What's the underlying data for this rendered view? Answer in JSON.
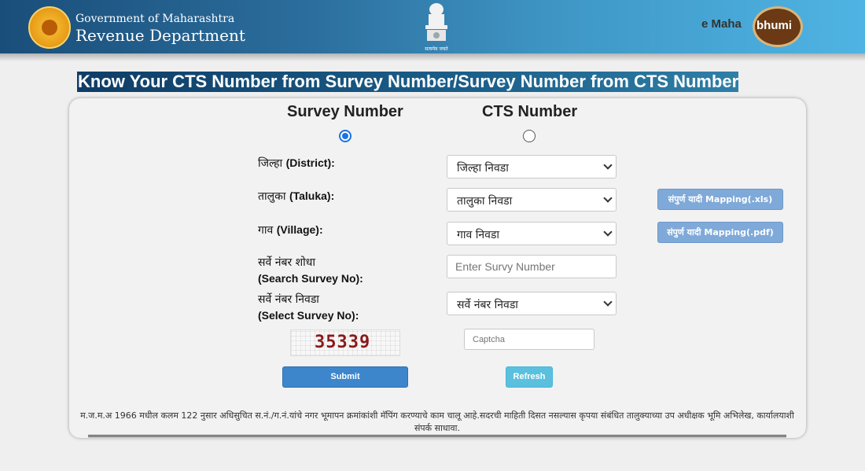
{
  "header": {
    "gov_line1": "Government of Maharashtra",
    "gov_line2": "Revenue Department",
    "emblem_motto": "सत्यमेव जयते",
    "brand_part1": "e Maha",
    "brand_part2": "bhumi"
  },
  "page_title": "Know Your CTS Number from Survey Number/Survey Number from CTS Number",
  "options": {
    "survey_label": "Survey Number",
    "cts_label": "CTS Number",
    "selected": "survey"
  },
  "form": {
    "district_label_mr": "जिल्हा",
    "district_label_en": "(District):",
    "district_value": "जिल्हा निवडा",
    "taluka_label_mr": "तालुका",
    "taluka_label_en": "(Taluka):",
    "taluka_value": "तालुका निवडा",
    "village_label_mr": "गाव",
    "village_label_en": "(Village):",
    "village_value": "गाव निवडा",
    "search_label_mr": "सर्वे नंबर शोधा",
    "search_label_en": "(Search Survey No):",
    "search_placeholder": "Enter Survy Number",
    "select_label_mr": "सर्वे नंबर निवडा",
    "select_label_en": "(Select Survey No):",
    "select_value": "सर्वे नंबर निवडा",
    "captcha_code": "35339",
    "captcha_placeholder": "Captcha"
  },
  "buttons": {
    "mapping_xls": "संपुर्ण यादी Mapping(.xls)",
    "mapping_pdf": "संपुर्ण यादी Mapping(.pdf)",
    "submit": "Submit",
    "refresh": "Refresh"
  },
  "note": "म.ज.म.अ 1966 मधील कलम 122 नुसार अधिसुचित स.नं./ग.नं.यांचे नगर भूमापन क्रमांकांशी मॅपिंग करण्याचे काम चालू आहे.सदरची माहिती दिसत नसल्यास कृपया संबंधित तालुक्याच्या उप अधीक्षक भूमि अभिलेख, कार्यालयाशी संपर्क साधावा.",
  "colors": {
    "header_start": "#1a4e7a",
    "header_end": "#4fb4e3",
    "submit": "#3d86cc",
    "refresh": "#5bc0de",
    "mapping": "#7fa9d8"
  }
}
